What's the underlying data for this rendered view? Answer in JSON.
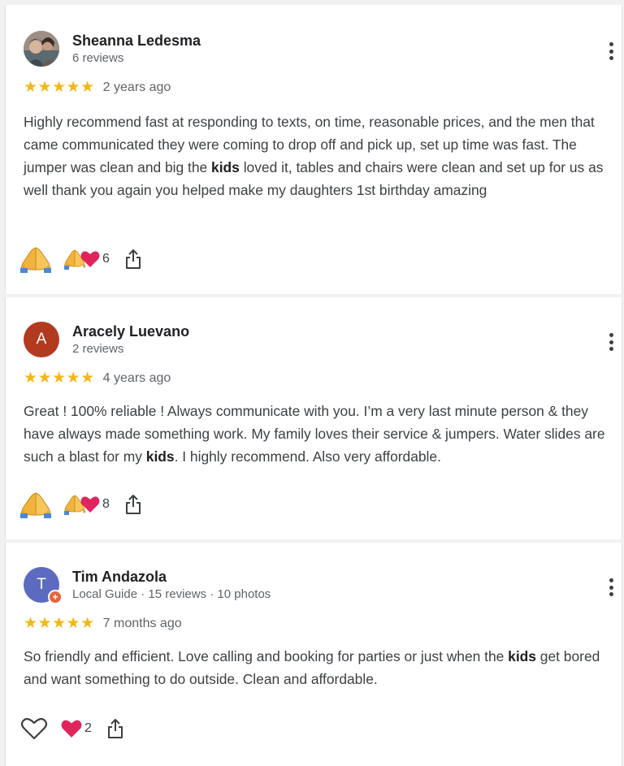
{
  "reviews": [
    {
      "author": "Sheanna Ledesma",
      "meta": "6 reviews",
      "avatar_icon": "person-photo-avatar",
      "stars": "★★★★★",
      "rating": 5,
      "when": "2 years ago",
      "text_parts": [
        "Highly recommend fast at responding to texts, on time, reasonable prices, and the men that came communicated they were coming to drop off and pick up, set up time was fast. The jumper was clean and big the ",
        "kids",
        " loved it, tables and chairs were clean and set up for us as well thank you again you helped make my daughters 1st birthday amazing"
      ],
      "reaction_count": "6"
    },
    {
      "author": "Aracely Luevano",
      "meta": "2 reviews",
      "avatar_letter": "A",
      "avatar_color": "#b23a1f",
      "stars": "★★★★★",
      "rating": 5,
      "when": "4 years ago",
      "text_parts": [
        "Great ! 100% reliable ! Always communicate with you. I’m a very last minute person & they have always made something work. My family loves their service & jumpers. Water slides are such a blast for my ",
        "kids",
        ". I highly recommend. Also very affordable."
      ],
      "reaction_count": "8"
    },
    {
      "author": "Tim Andazola",
      "meta": "Local Guide · 15 reviews · 10 photos",
      "avatar_letter": "T",
      "avatar_color": "#5c6bc0",
      "stars": "★★★★★",
      "rating": 5,
      "when": "7 months ago",
      "text_parts": [
        "So friendly and efficient. Love calling and booking for parties or just when the ",
        "kids",
        " get bored and want something to do outside. Clean and affordable."
      ],
      "reaction_count": "2"
    }
  ],
  "colors": {
    "star": "#f3b71b",
    "heart": "#e0245e",
    "pray": "#f2b33d"
  },
  "icons": [
    "pray-icon",
    "heart-icon",
    "share-icon",
    "more-vert-icon",
    "local-guide-badge-icon"
  ]
}
